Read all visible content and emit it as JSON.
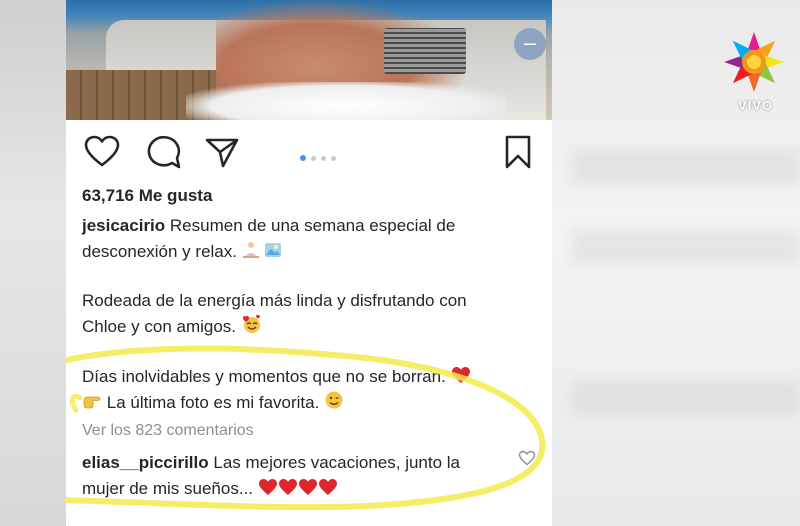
{
  "post": {
    "likes": "63,716 Me gusta",
    "caption": {
      "username": "jesicacirio",
      "line1": "Resumen de una semana especial de",
      "line2": "desconexión y relax.",
      "para2_line1": "Rodeada de la energía más linda y disfrutando con",
      "para2_line2": "Chloe y con amigos.",
      "para3_line1": "Días inolvidables y momentos que no se borran.",
      "para3_line2": "La última foto es mi favorita."
    },
    "view_comments": "Ver los 823 comentarios",
    "comment": {
      "username": "elias__piccirillo",
      "line1": "Las mejores vacaciones, junto la",
      "line2": "mujer de mis sueños..."
    }
  },
  "carousel": {
    "count": 4,
    "active_index": 0
  },
  "channel": {
    "live_label": "VIVO"
  },
  "icons": [
    "heart-icon",
    "comment-icon",
    "share-icon",
    "bookmark-icon",
    "minus-icon",
    "channel-logo"
  ],
  "colors": {
    "highlight": "#f2ea4a",
    "text": "#262626",
    "muted": "#8e8e8e",
    "dot_active": "#3897f0",
    "heart": "#e0262d"
  }
}
